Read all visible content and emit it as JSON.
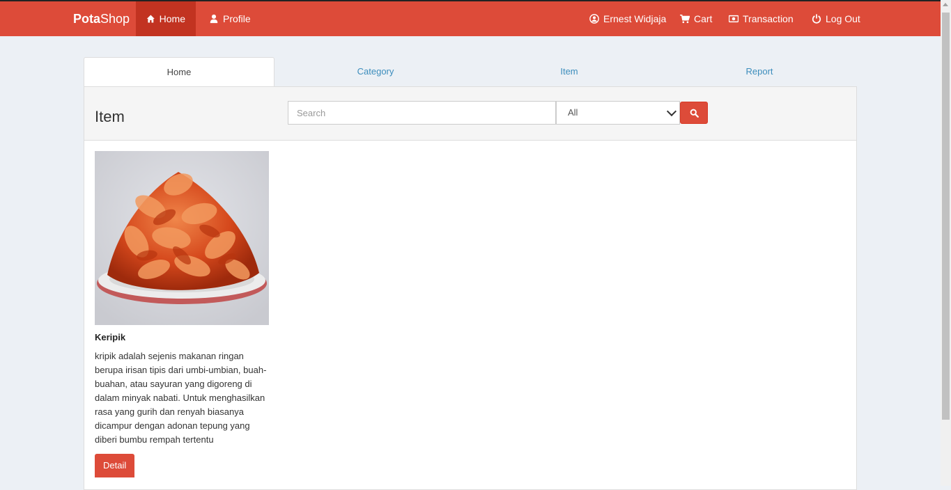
{
  "navbar": {
    "brand_bold": "Pota",
    "brand_rest": "Shop",
    "left": [
      {
        "label": "Home",
        "icon": "home-icon",
        "active": true
      },
      {
        "label": "Profile",
        "icon": "user-icon",
        "active": false
      }
    ],
    "right": [
      {
        "label": "Ernest Widjaja",
        "icon": "user-circle-icon"
      },
      {
        "label": "Cart",
        "icon": "cart-icon"
      },
      {
        "label": "Transaction",
        "icon": "money-icon"
      },
      {
        "label": "Log Out",
        "icon": "power-icon"
      }
    ]
  },
  "tabs": [
    "Home",
    "Category",
    "Item",
    "Report"
  ],
  "panel": {
    "title": "Item",
    "search_placeholder": "Search",
    "filter_selected": "All"
  },
  "items": [
    {
      "name": "Keripik",
      "description": "kripik adalah sejenis makanan ringan berupa irisan tipis dari umbi-umbian, buah-buahan, atau sayuran yang digoreng di dalam minyak nabati. Untuk menghasilkan rasa yang gurih dan renyah biasanya dicampur dengan adonan tepung yang diberi bumbu rempah tertentu",
      "button": "Detail"
    }
  ],
  "colors": {
    "accent": "#dd4b39",
    "accent_dark": "#c23321",
    "link": "#3c8dbc"
  }
}
